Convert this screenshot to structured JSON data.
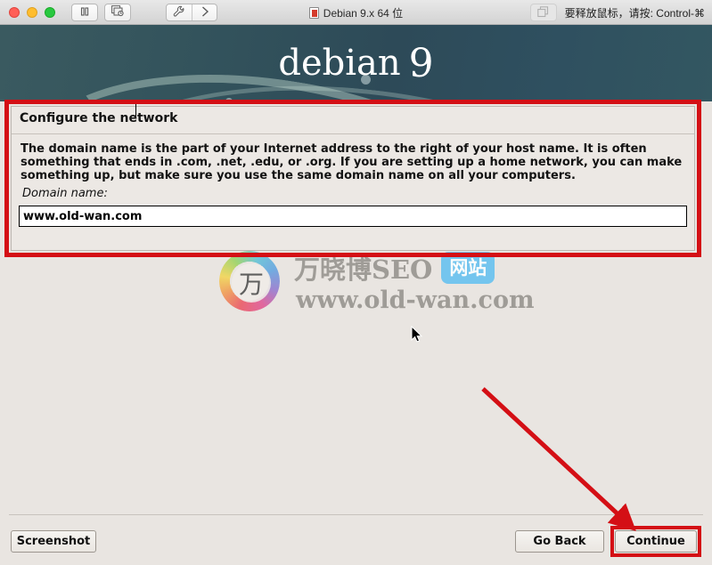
{
  "window": {
    "title": "Debian 9.x 64 位",
    "release_hint": "要释放鼠标，请按: Control-⌘",
    "traffic_lights": [
      "close-button",
      "minimize-button",
      "maximize-button"
    ],
    "toolbar": {
      "pause_icon": "pause-icon",
      "snapshot_icon": "snapshot-icon",
      "settings_icon": "wrench-icon",
      "forward_icon": "chevron-right-icon",
      "unity_icon": "windows-overlap-icon",
      "doc_icon": "vm-document-icon"
    }
  },
  "banner": {
    "brand": "debian",
    "version": "9"
  },
  "dialog": {
    "title": "Configure the network",
    "description": "The domain name is the part of your Internet address to the right of your host name.  It is often something that ends in .com, .net, .edu, or .org.  If you are setting up a home network, you can make something up, but make sure you use the same domain name on all your computers.",
    "field_label": "Domain name:",
    "field_value": "www.old-wan.com",
    "field_placeholder": ""
  },
  "watermark": {
    "logo_glyph": "万",
    "brand": "万晓博SEO",
    "badge": "网站",
    "url": "www.old-wan.com"
  },
  "buttons": {
    "screenshot": "Screenshot",
    "go_back": "Go Back",
    "continue": "Continue"
  },
  "annotations": {
    "highlight_color": "#d40f15",
    "arrow": "red-arrow-pointing-to-continue",
    "cursor": "mouse-pointer"
  }
}
